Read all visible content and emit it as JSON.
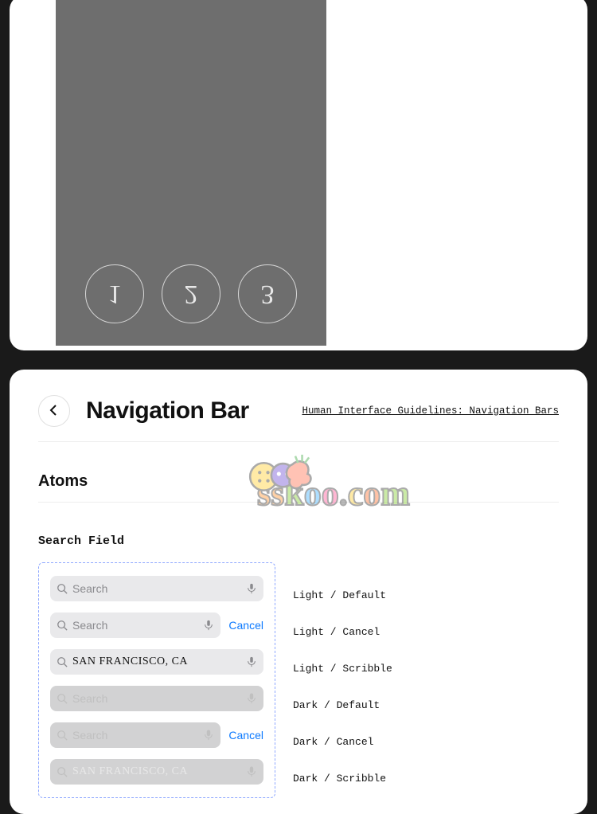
{
  "top_preview": {
    "page_indicators": [
      "1",
      "2",
      "3"
    ]
  },
  "header": {
    "title": "Navigation Bar",
    "hig_link": "Human Interface Guidelines: Navigation Bars"
  },
  "sections": {
    "atoms_title": "Atoms",
    "search_field_title": "Search Field"
  },
  "search_fields": [
    {
      "mode": "light",
      "placeholder": "Search",
      "cancel": "",
      "scribble": "",
      "label": "Light / Default"
    },
    {
      "mode": "light",
      "placeholder": "Search",
      "cancel": "Cancel",
      "scribble": "",
      "label": "Light / Cancel"
    },
    {
      "mode": "light",
      "placeholder": "",
      "cancel": "",
      "scribble": "SAN FRANCISCO, CA",
      "label": "Light / Scribble"
    },
    {
      "mode": "dark",
      "placeholder": "Search",
      "cancel": "",
      "scribble": "",
      "label": "Dark / Default"
    },
    {
      "mode": "dark",
      "placeholder": "Search",
      "cancel": "Cancel",
      "scribble": "",
      "label": "Dark / Cancel"
    },
    {
      "mode": "dark",
      "placeholder": "",
      "cancel": "",
      "scribble": "SAN FRANCISCO, CA",
      "label": "Dark / Scribble"
    }
  ],
  "watermark": {
    "text_parts": [
      "s",
      "s",
      "k",
      "o",
      "o",
      ".",
      "c",
      "o",
      "m"
    ],
    "colors": [
      "#ff9a3c",
      "#ff9a3c",
      "#8bd13c",
      "#4bb8ff",
      "#ff5fa0",
      "#666",
      "#ffd23c",
      "#ff7a3c",
      "#8bd13c"
    ]
  }
}
